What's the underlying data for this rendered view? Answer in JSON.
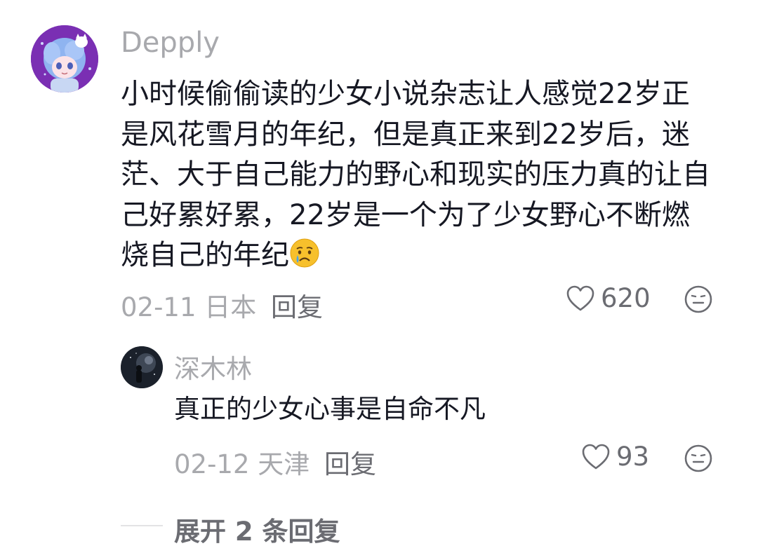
{
  "comment": {
    "username": "Depply",
    "text": "小时候偷偷读的少女小说杂志让人感觉22岁正是风花雪月的年纪，但是真正来到22岁后，迷茫、大于自己能力的野心和现实的压力真的让自己好累好累，22岁是一个为了少女野心不断燃烧自己的年纪",
    "emoji": "crying-face-emoji",
    "meta": "02-11 日本",
    "reply_label": "回复",
    "likes": "620",
    "avatar_color": "#7a2fb3"
  },
  "reply": {
    "username": "深木林",
    "text": "真正的少女心事是自命不凡",
    "meta": "02-12 天津",
    "reply_label": "回复",
    "likes": "93"
  },
  "expand": {
    "label": "展开 2 条回复"
  },
  "colors": {
    "text": "#161823",
    "muted": "#a8a9ad",
    "secondary": "#6b6c72"
  }
}
